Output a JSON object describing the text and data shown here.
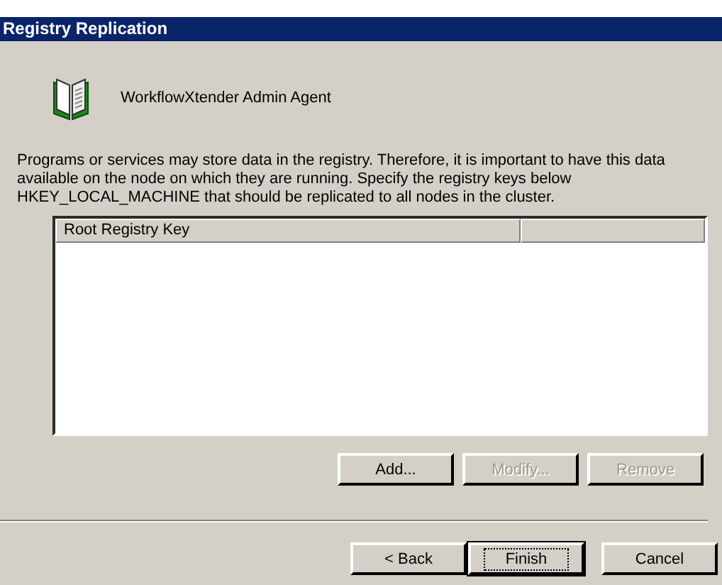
{
  "window": {
    "title": "Registry Replication"
  },
  "header": {
    "title": "WorkflowXtender Admin Agent"
  },
  "description": "Programs or services may store data in the registry. Therefore, it is important to have this data available on the node on which they are running. Specify the registry keys below HKEY_LOCAL_MACHINE that should be replicated to all nodes in the cluster.",
  "table": {
    "columns": [
      "Root Registry Key"
    ]
  },
  "list_buttons": [
    {
      "label": "Add...",
      "disabled": false
    },
    {
      "label": "Modify...",
      "disabled": true
    },
    {
      "label": "Remove",
      "disabled": true
    }
  ],
  "buttons": [
    {
      "label": "< Back",
      "default": false
    },
    {
      "label": "Finish",
      "default": true
    },
    {
      "label": "Cancel",
      "default": false
    }
  ]
}
